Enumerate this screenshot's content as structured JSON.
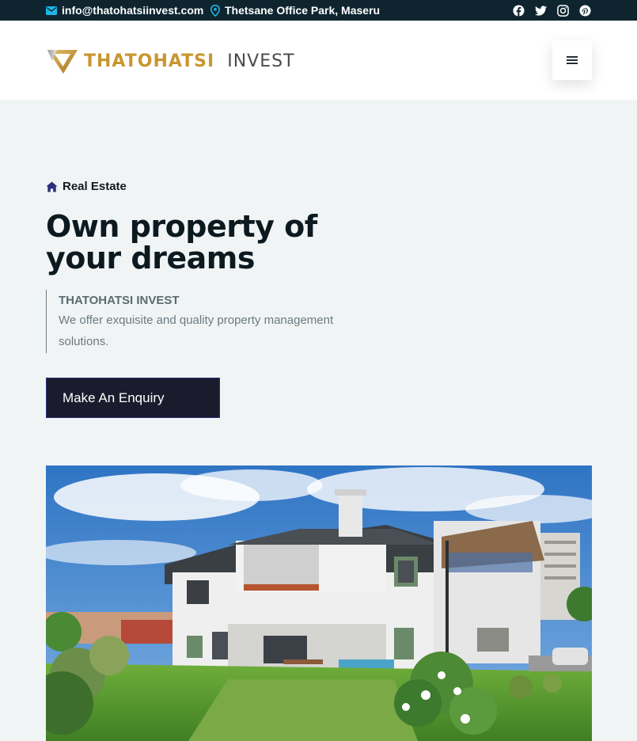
{
  "topbar": {
    "email": "info@thatohatsiinvest.com",
    "address": "Thetsane Office Park, Maseru",
    "social_icons": [
      "facebook-icon",
      "twitter-icon",
      "instagram-icon",
      "pinterest-icon"
    ]
  },
  "header": {
    "logo_brand": "THATOHATSI",
    "logo_sub": "INVEST",
    "menu_icon": "hamburger-icon"
  },
  "hero": {
    "kicker": "Real Estate",
    "title": "Own property of your dreams",
    "quote_title": "THATOHATSI INVEST",
    "quote_text": "We offer exquisite and quality property management solutions.",
    "cta_label": "Make An Enquiry"
  },
  "colors": {
    "topbar_bg": "#0e2530",
    "accent_gold": "#c8962e",
    "cta_bg": "#1a1c2e",
    "page_bg": "#f1f4f5"
  }
}
